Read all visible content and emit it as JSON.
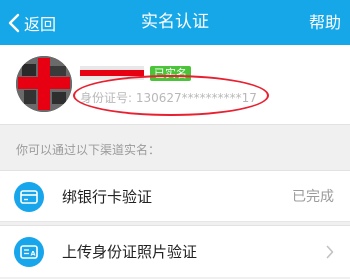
{
  "header": {
    "back_label": "返回",
    "title": "实名认证",
    "help_label": "帮助",
    "color": "#16a7e8"
  },
  "profile": {
    "badge": "已实名",
    "id_text": "身份证号: 130627**********17"
  },
  "section_label": "你可以通过以下渠道实名：",
  "methods": [
    {
      "label": "绑银行卡验证",
      "status": "已完成",
      "icon": "bank-card-icon"
    },
    {
      "label": "上传身份证照片验证",
      "status": "",
      "icon": "id-card-icon"
    }
  ],
  "colors": {
    "badge": "#4cc43a",
    "annotation": "#e8202f",
    "icon_bg": "#17a5ec"
  }
}
